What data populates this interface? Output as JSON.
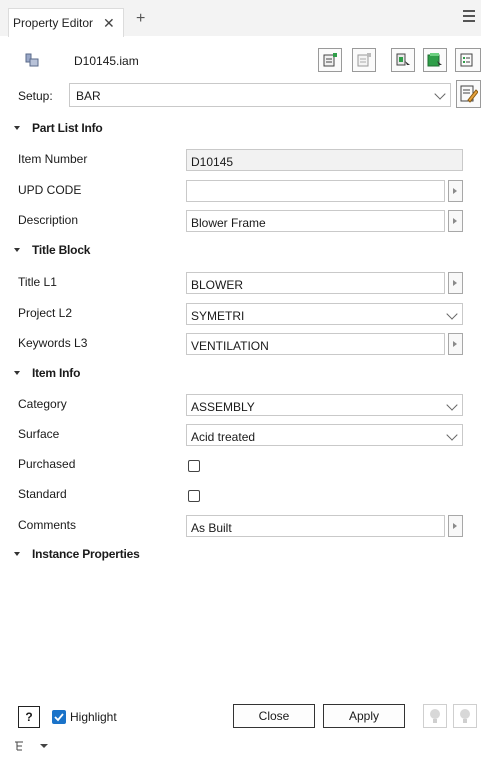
{
  "tab": {
    "title": "Property Editor"
  },
  "header": {
    "filename": "D10145.iam"
  },
  "setup": {
    "label": "Setup:",
    "value": "BAR"
  },
  "sections": {
    "part_list": "Part List Info",
    "title_block": "Title Block",
    "item_info": "Item Info",
    "instance": "Instance Properties"
  },
  "fields": {
    "item_number": {
      "label": "Item Number",
      "value": "D10145"
    },
    "upd_code": {
      "label": "UPD CODE",
      "value": ""
    },
    "description": {
      "label": "Description",
      "value": "Blower Frame"
    },
    "title_l1": {
      "label": "Title L1",
      "value": "BLOWER"
    },
    "project_l2": {
      "label": "Project L2",
      "value": "SYMETRI"
    },
    "keywords_l3": {
      "label": "Keywords L3",
      "value": "VENTILATION"
    },
    "category": {
      "label": "Category",
      "value": "ASSEMBLY"
    },
    "surface": {
      "label": "Surface",
      "value": "Acid treated"
    },
    "purchased": {
      "label": "Purchased"
    },
    "standard": {
      "label": "Standard"
    },
    "comments": {
      "label": "Comments",
      "value": "As Built"
    }
  },
  "bottom": {
    "help": "?",
    "highlight": "Highlight",
    "close": "Close",
    "apply": "Apply"
  },
  "colors": {
    "accent": "#1a73c9",
    "green": "#2e9e48"
  }
}
